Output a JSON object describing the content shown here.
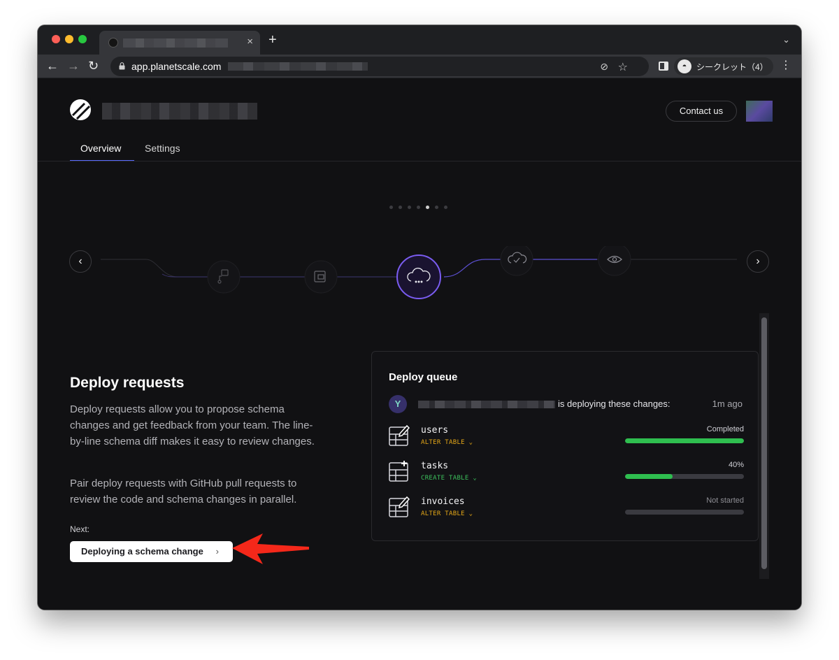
{
  "browser": {
    "tab_close": "×",
    "new_tab": "+",
    "tab_menu": "⌄",
    "url": "app.planetscale.com",
    "incognito_label": "シークレット（4）"
  },
  "header": {
    "contact_label": "Contact us"
  },
  "tabs": [
    {
      "label": "Overview",
      "active": true
    },
    {
      "label": "Settings",
      "active": false
    }
  ],
  "carousel": {
    "page_count": 7,
    "active_index": 4,
    "prev": "‹",
    "next": "›",
    "stage_icons": [
      "branch-icon",
      "branch-square-icon",
      "cloud-deploy-icon",
      "cloud-check-icon",
      "eye-icon"
    ],
    "active_stage": 2
  },
  "content": {
    "title": "Deploy requests",
    "paragraph1": "Deploy requests allow you to propose schema changes and get feedback from your team. The line-by-line schema diff makes it easy to review changes.",
    "paragraph2": "Pair deploy requests with GitHub pull requests to review the code and schema changes in parallel.",
    "next_label": "Next:",
    "next_button": "Deploying a schema change"
  },
  "queue": {
    "title": "Deploy queue",
    "deploying_text": "is deploying these changes:",
    "time": "1m ago",
    "avatar_glyph": "Y",
    "changes": [
      {
        "name": "users",
        "kind": "ALTER TABLE",
        "kind_color": "#e6a817",
        "status": "Completed",
        "progress": 1.0,
        "icon": "table-edit-icon"
      },
      {
        "name": "tasks",
        "kind": "CREATE TABLE",
        "kind_color": "#3cc05c",
        "status": "40%",
        "progress": 0.4,
        "icon": "table-add-icon"
      },
      {
        "name": "invoices",
        "kind": "ALTER TABLE",
        "kind_color": "#e6a817",
        "status": "Not started",
        "progress": 0.0,
        "icon": "table-edit-icon"
      }
    ]
  },
  "colors": {
    "accent": "#7a5cf0",
    "progress": "#2fbe4f",
    "arrow": "#f5281a"
  }
}
